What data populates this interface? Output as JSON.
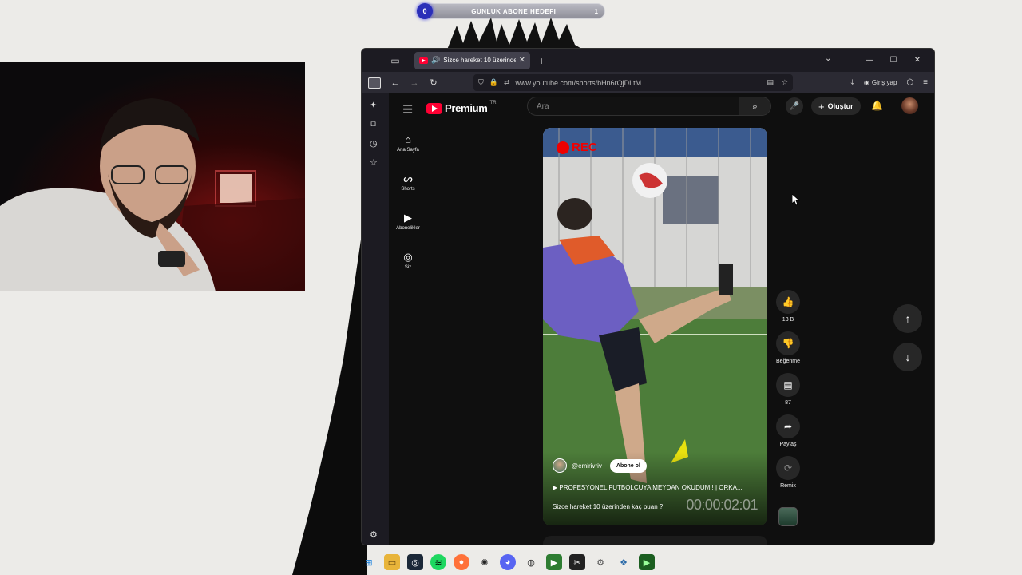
{
  "overlay": {
    "goal_title": "GUNLUK ABONE HEDEFI",
    "goal_current": "0",
    "goal_target": "1"
  },
  "browser": {
    "tab_title": "Sizce hareket 10 üzerinden",
    "url": "www.youtube.com/shorts/bHn6rQjDLtM",
    "login_label": "Giriş yap"
  },
  "youtube": {
    "brand": "Premium",
    "country": "TR",
    "search_placeholder": "Ara",
    "create_label": "Oluştur",
    "guide": [
      {
        "label": "Ana Sayfa",
        "icon": "home-icon"
      },
      {
        "label": "Shorts",
        "icon": "shorts-icon"
      },
      {
        "label": "Abonelikler",
        "icon": "subscriptions-icon"
      },
      {
        "label": "Siz",
        "icon": "you-icon"
      }
    ],
    "short": {
      "rec_label": "REC",
      "channel": "@emirivriv",
      "subscribe_label": "Abone ol",
      "linked_video": "PROFESYONEL FUTBOLCUYA MEYDAN OKUDUM ! | ORKA...",
      "caption": "Sizce hareket 10 üzerinden kaç puan ?",
      "timer": "00:00:02:01"
    },
    "actions": {
      "likes": "13 B",
      "dislike_label": "Beğenme",
      "comments": "87",
      "share_label": "Paylaş",
      "remix_label": "Remix"
    }
  },
  "colors": {
    "yt_red": "#ff0033",
    "yt_bg": "#0f0f0f",
    "browser_chrome": "#2b2a33"
  }
}
